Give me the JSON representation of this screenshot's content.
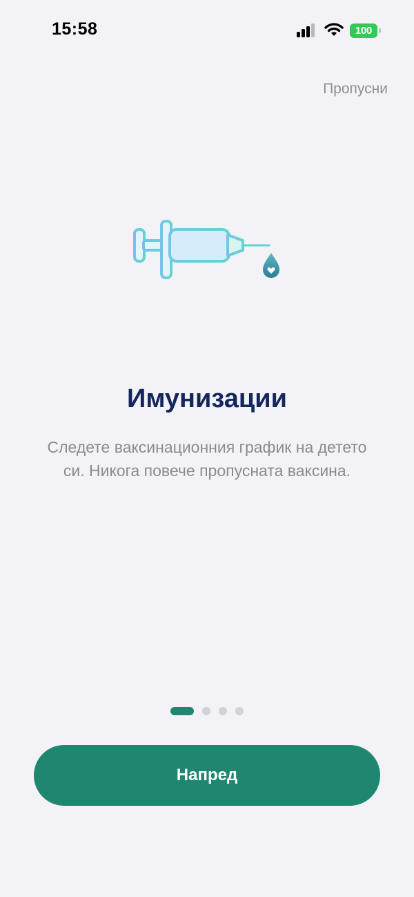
{
  "status_bar": {
    "time": "15:58",
    "battery": "100",
    "battery_color": "#34c759"
  },
  "onboarding": {
    "skip_label": "Пропусни",
    "illustration_icon": "syringe-icon",
    "title": "Имунизации",
    "description": "Следете ваксинационния график на детето си. Никога повече пропусната ваксина.",
    "page_count": 4,
    "current_page": 1,
    "next_label": "Напред"
  },
  "colors": {
    "accent": "#1f8670",
    "title": "#14275c",
    "text_secondary": "#8a8a8f",
    "background": "#f2f2f7"
  }
}
